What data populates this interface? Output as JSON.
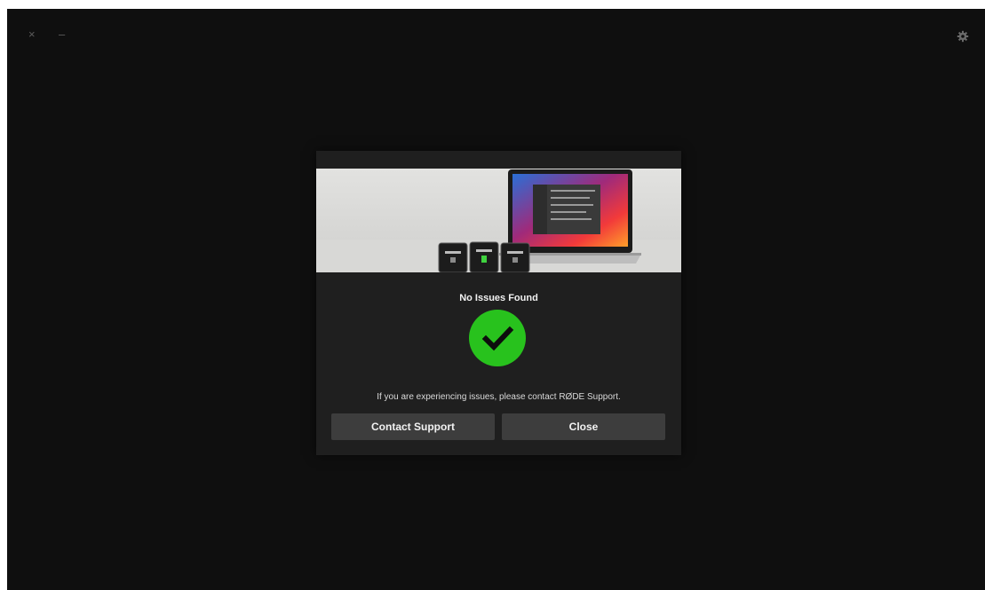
{
  "window": {
    "close_glyph": "×",
    "minimize_glyph": "–",
    "settings_icon": "gear-icon"
  },
  "dialog": {
    "title": "No Issues Found",
    "status_icon": "checkmark-icon",
    "status_color": "#28c21d",
    "message": "If you are experiencing issues, please contact RØDE Support.",
    "buttons": {
      "contact_support": "Contact Support",
      "close": "Close"
    }
  },
  "colors": {
    "background": "#0f0f0f",
    "dialog": "#1f1f1f",
    "button": "#3d3d3d"
  }
}
